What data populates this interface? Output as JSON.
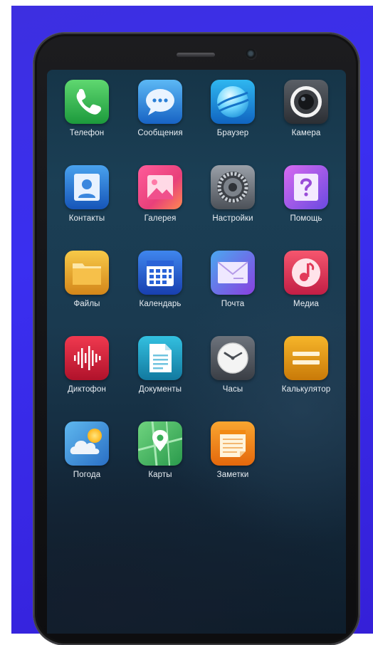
{
  "apps": [
    {
      "label": "Телефон",
      "icon": "phone-icon",
      "color": "#2fb24e"
    },
    {
      "label": "Сообщения",
      "icon": "message-bubble-icon",
      "color": "#1e7fd8"
    },
    {
      "label": "Браузер",
      "icon": "browser-globe-icon",
      "color": "#1b8fd6"
    },
    {
      "label": "Камера",
      "icon": "camera-lens-icon",
      "color": "#3b3e44"
    },
    {
      "label": "Контакты",
      "icon": "contact-card-icon",
      "color": "#2373d0"
    },
    {
      "label": "Галерея",
      "icon": "gallery-photo-icon",
      "color": "#e8477f"
    },
    {
      "label": "Настройки",
      "icon": "settings-gear-icon",
      "color": "#6a6f78"
    },
    {
      "label": "Помощь",
      "icon": "help-question-icon",
      "color": "#b54ad6"
    },
    {
      "label": "Файлы",
      "icon": "folder-icon",
      "color": "#e3a21a"
    },
    {
      "label": "Календарь",
      "icon": "calendar-icon",
      "color": "#1f55c9"
    },
    {
      "label": "Почта",
      "icon": "mail-envelope-icon",
      "color": "#7a4fdc"
    },
    {
      "label": "Медиа",
      "icon": "music-note-icon",
      "color": "#e13a57"
    },
    {
      "label": "Диктофон",
      "icon": "voice-recorder-icon",
      "color": "#d62035"
    },
    {
      "label": "Документы",
      "icon": "document-icon",
      "color": "#1f9bc2"
    },
    {
      "label": "Часы",
      "icon": "clock-icon",
      "color": "#5a6068"
    },
    {
      "label": "Калькулятор",
      "icon": "calculator-icon",
      "color": "#e39a12"
    },
    {
      "label": "Погода",
      "icon": "weather-cloud-sun-icon",
      "color": "#3a8fd0"
    },
    {
      "label": "Карты",
      "icon": "map-pin-icon",
      "color": "#3cae55"
    },
    {
      "label": "Заметки",
      "icon": "notes-icon",
      "color": "#f28a14"
    }
  ]
}
